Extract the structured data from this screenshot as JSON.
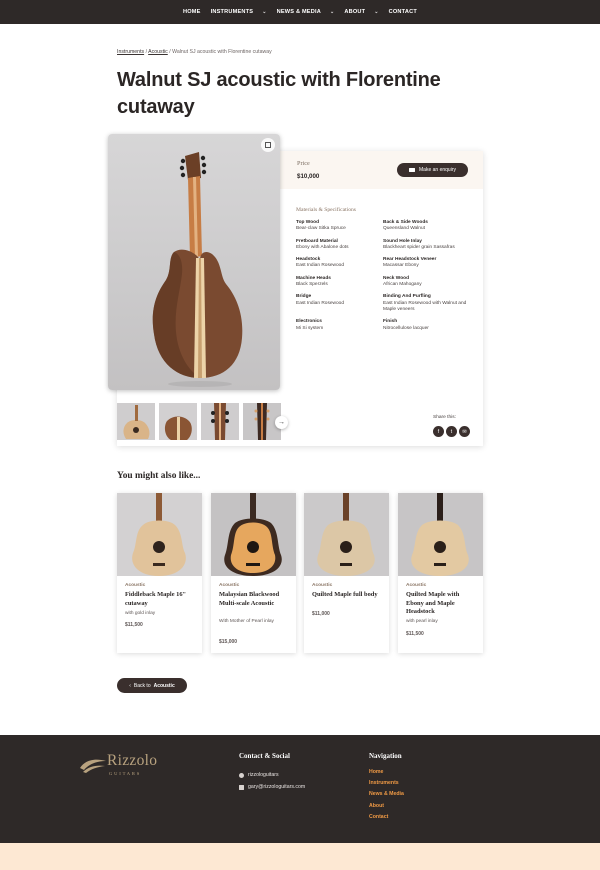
{
  "nav": {
    "items": [
      "HOME",
      "INSTRUMENTS",
      "NEWS & MEDIA",
      "ABOUT",
      "CONTACT"
    ]
  },
  "breadcrumb": {
    "items": [
      "Instruments",
      "Acoustic"
    ],
    "current": "Walnut SJ acoustic with Florentine cutaway",
    "separator": "/"
  },
  "product": {
    "title": "Walnut SJ acoustic with Florentine cutaway",
    "price_label": "Price",
    "price": "$10,000",
    "enquiry_label": "Make an enquiry",
    "specs_heading": "Materials & Specifications",
    "specs": [
      {
        "key": "Top Wood",
        "value": "Bear-claw Sitka Spruce"
      },
      {
        "key": "Back & Side Woods",
        "value": "Queensland Walnut"
      },
      {
        "key": "Fretboard Material",
        "value": "Ebony with Abalone dots"
      },
      {
        "key": "Sound Hole Inlay",
        "value": "Blackheart spider grain Sassafras"
      },
      {
        "key": "Headstock",
        "value": "East Indian Rosewood"
      },
      {
        "key": "Rear Headstock Veneer",
        "value": "Macassar Ebony"
      },
      {
        "key": "Machine Heads",
        "value": "Black Sperzels"
      },
      {
        "key": "Neck Wood",
        "value": "African Mahogany"
      },
      {
        "key": "Bridge",
        "value": "East Indian Rosewood"
      },
      {
        "key": "Binding And Purfling",
        "value": "East Indian Rosewood with Walnut and Maple veneers"
      },
      {
        "key": "Electronics",
        "value": "Mi Si system"
      },
      {
        "key": "Finish",
        "value": "Nitrocellulose lacquer"
      }
    ],
    "share_label": "Share this:",
    "share_icons": [
      "f",
      "t",
      "✉"
    ]
  },
  "related": {
    "heading": "You might also like...",
    "items": [
      {
        "category": "Acoustic",
        "name": "Fiddleback Maple 16\" cutaway",
        "sub": "with gold inlay",
        "price": "$11,500"
      },
      {
        "category": "Acoustic",
        "name": "Malaysian Blackwood Multi-scale Acoustic",
        "sub": "With Mother of Pearl inlay",
        "price": "$15,000"
      },
      {
        "category": "Acoustic",
        "name": "Quilted Maple full body",
        "sub": "",
        "price": "$11,000"
      },
      {
        "category": "Acoustic",
        "name": "Quilted Maple with Ebony and Maple Headstock",
        "sub": "with pearl inlay",
        "price": "$11,500"
      }
    ]
  },
  "back": {
    "prefix": "Back to",
    "target": "Acoustic"
  },
  "footer": {
    "logo_word": "Rizzolo",
    "logo_sub": "GUITARS",
    "contact_heading": "Contact & Social",
    "facebook": "rizzologuitars",
    "email": "gary@rizzologuitars.com",
    "nav_heading": "Navigation",
    "links": [
      "Home",
      "Instruments",
      "News & Media",
      "About",
      "Contact"
    ]
  },
  "colors": {
    "dark": "#2e2928",
    "accent_link": "#f09a45",
    "logo": "#b8a27f",
    "price_band": "#fbf6f1",
    "bottom_band": "#fde8d3"
  }
}
